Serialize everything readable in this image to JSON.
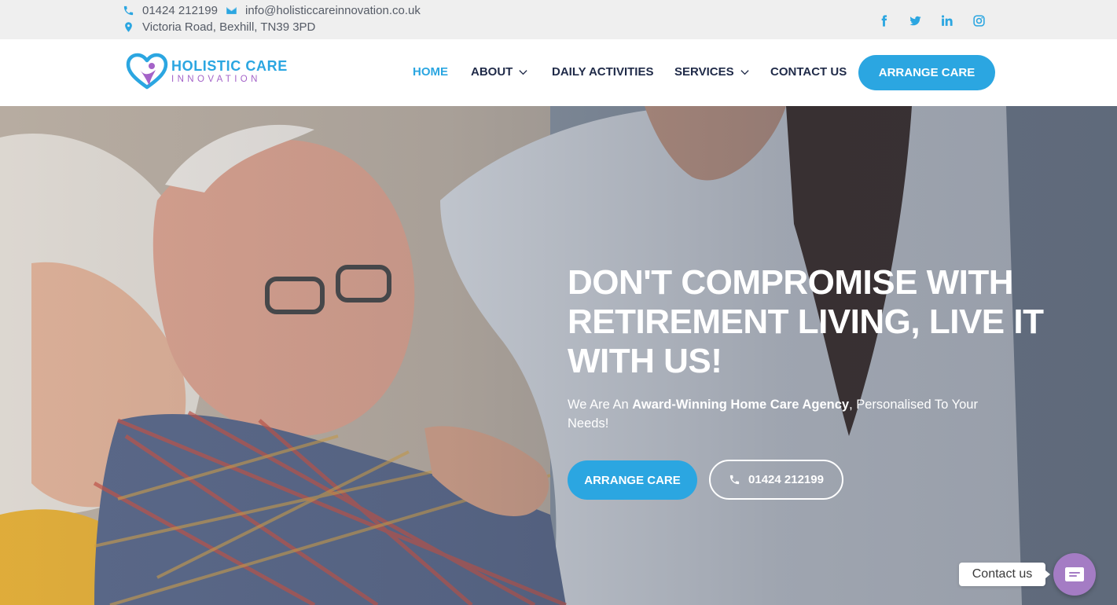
{
  "topbar": {
    "phone": "01424 212199",
    "email": "info@holisticcareinnovation.co.uk",
    "address": "Victoria Road, Bexhill, TN39 3PD",
    "social": [
      "facebook-icon",
      "twitter-icon",
      "linkedin-icon",
      "instagram-icon"
    ]
  },
  "logo": {
    "line1": "HOLISTIC CARE",
    "line2": "INNOVATION"
  },
  "nav": {
    "home": "HOME",
    "about": "ABOUT",
    "daily": "DAILY ACTIVITIES",
    "services": "SERVICES",
    "contact": "CONTACT US",
    "cta": "ARRANGE CARE"
  },
  "hero": {
    "title": "DON'T COMPROMISE WITH RETIREMENT LIVING, LIVE IT WITH US!",
    "sub_pre": "We Are An ",
    "sub_bold": "Award-Winning Home Care Agency",
    "sub_post": ", Personalised To Your Needs!",
    "btn_arrange": "ARRANGE CARE",
    "btn_phone": "01424 212199"
  },
  "widget": {
    "label": "Contact us"
  },
  "colors": {
    "accent": "#2ba6e1",
    "navy": "#1f2a48",
    "purple": "#a463c8",
    "widget": "#a47cc4"
  }
}
